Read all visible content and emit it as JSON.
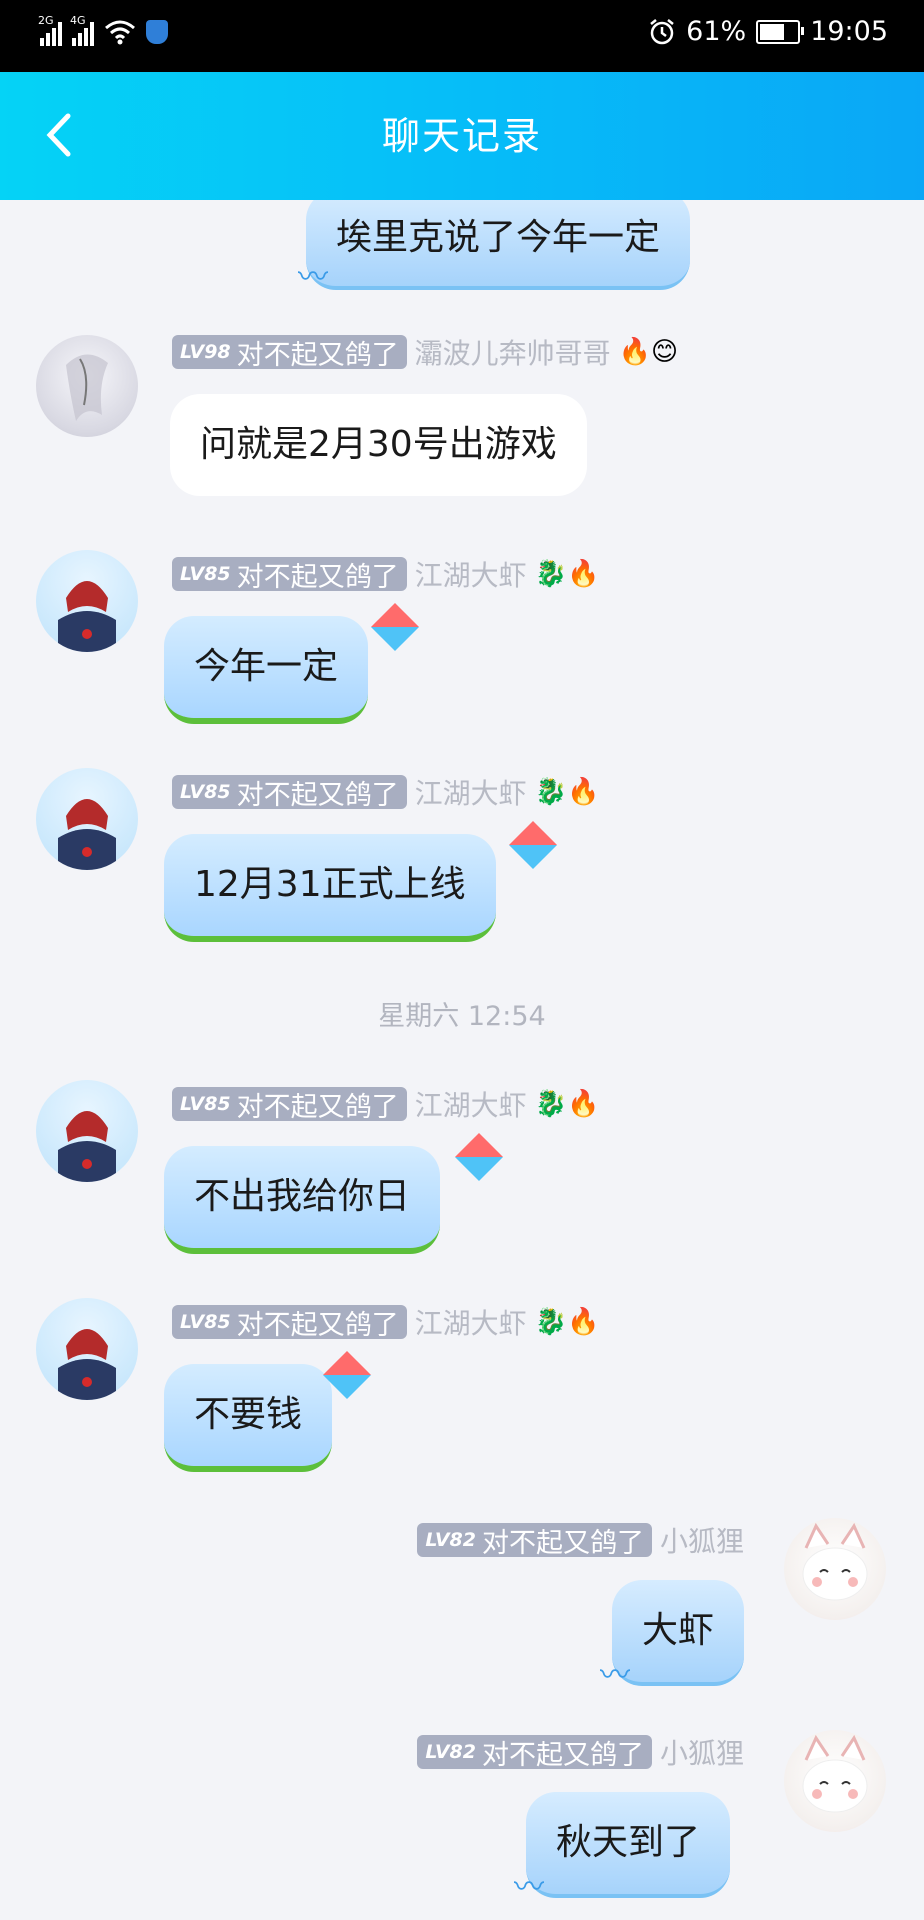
{
  "status_bar": {
    "network1": "2G",
    "network2": "4G",
    "battery": "61%",
    "time": "19:05",
    "icons": [
      "signal-icon",
      "wifi-icon",
      "shield-icon",
      "alarm-icon",
      "battery-icon"
    ]
  },
  "header": {
    "title": "聊天记录",
    "back_icon": "chevron-left-icon"
  },
  "colors": {
    "header_gradient_start": "#05d3f6",
    "header_gradient_end": "#0aa7f6",
    "background": "#f3f4f8",
    "badge_bg": "#a8aec1"
  },
  "messages": [
    {
      "side": "right",
      "text": "埃里克说了今年一定",
      "partial": true
    },
    {
      "side": "left",
      "level": "LV98",
      "title": "对不起又鸽了",
      "nickname": "灞波儿奔帅哥哥",
      "emoji": "🔥😊",
      "text": "问就是2月30号出游戏"
    },
    {
      "side": "left",
      "level": "LV85",
      "title": "对不起又鸽了",
      "nickname": "江湖大虾",
      "emoji": "🐉🔥",
      "text": "今年一定"
    },
    {
      "side": "left",
      "level": "LV85",
      "title": "对不起又鸽了",
      "nickname": "江湖大虾",
      "emoji": "🐉🔥",
      "text": "12月31正式上线"
    },
    {
      "timestamp": "星期六 12:54"
    },
    {
      "side": "left",
      "level": "LV85",
      "title": "对不起又鸽了",
      "nickname": "江湖大虾",
      "emoji": "🐉🔥",
      "text": "不出我给你日"
    },
    {
      "side": "left",
      "level": "LV85",
      "title": "对不起又鸽了",
      "nickname": "江湖大虾",
      "emoji": "🐉🔥",
      "text": "不要钱"
    },
    {
      "side": "right",
      "level": "LV82",
      "title": "对不起又鸽了",
      "nickname": "小狐狸",
      "text": "大虾"
    },
    {
      "side": "right",
      "level": "LV82",
      "title": "对不起又鸽了",
      "nickname": "小狐狸",
      "text": "秋天到了"
    }
  ]
}
